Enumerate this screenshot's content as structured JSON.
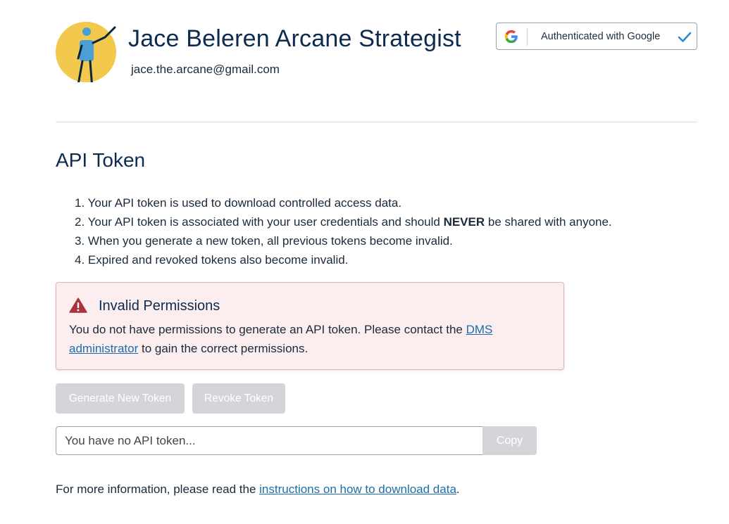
{
  "profile": {
    "name": "Jace Beleren Arcane Strategist",
    "email": "jace.the.arcane@gmail.com"
  },
  "auth": {
    "label": "Authenticated with Google",
    "icon": "google-icon",
    "status_icon": "checkmark-icon"
  },
  "api_token": {
    "title": "API Token",
    "rules": [
      {
        "num": "1.",
        "text": "Your API token is used to download controlled access data."
      },
      {
        "num": "2.",
        "pre": "Your API token is associated with your user credentials and should ",
        "bold": "NEVER",
        "post": " be shared with anyone."
      },
      {
        "num": "3.",
        "text": "When you generate a new token, all previous tokens become invalid."
      },
      {
        "num": "4.",
        "text": "Expired and revoked tokens also become invalid."
      }
    ]
  },
  "alert": {
    "title": "Invalid Permissions",
    "message_pre": "You do not have permissions to generate an API token. Please contact the ",
    "link_text": "DMS administrator",
    "message_post": " to gain the correct permissions.",
    "icon": "warning-icon"
  },
  "buttons": {
    "generate": "Generate New Token",
    "revoke": "Revoke Token",
    "copy": "Copy"
  },
  "token_field": {
    "placeholder": "You have no API token..."
  },
  "footer": {
    "pre": "For more information, please read the ",
    "link_text": "instructions on how to download data",
    "post": "."
  },
  "colors": {
    "accent": "#1b6fa8",
    "heading": "#0d2b4e",
    "alert_bg": "#fcedee",
    "alert_icon": "#a8343d",
    "avatar_bg": "#f2c94c",
    "disabled_btn": "#d3d5d8"
  }
}
